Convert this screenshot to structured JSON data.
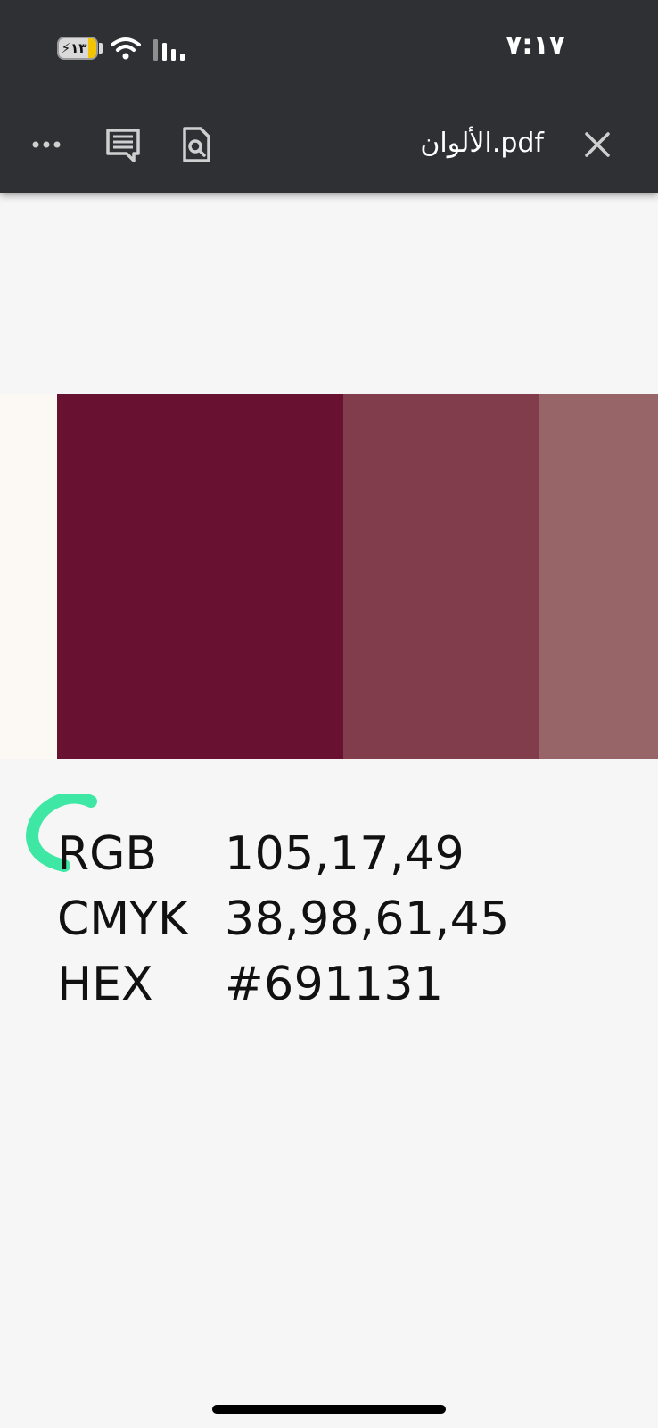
{
  "status_bar": {
    "time": "٧:١٧",
    "battery_label": "⚡١٣",
    "wifi_icon": "wifi-icon",
    "signal_icon": "cellular-signal-icon"
  },
  "toolbar": {
    "more_icon": "more-horizontal-icon",
    "comment_icon": "comment-icon",
    "search_icon": "document-search-icon",
    "title": "الألوان.pdf",
    "close_icon": "close-icon"
  },
  "swatches": [
    {
      "color": "#fcf9f5"
    },
    {
      "color": "#691131"
    },
    {
      "color": "#813d4c"
    },
    {
      "color": "#976467"
    }
  ],
  "color_info": [
    {
      "label": "RGB",
      "value": "105,17,49"
    },
    {
      "label": "CMYK",
      "value": "38,98,61,45"
    },
    {
      "label": "HEX",
      "value": "#691131"
    }
  ],
  "annotation_color": "#3ee8a4"
}
